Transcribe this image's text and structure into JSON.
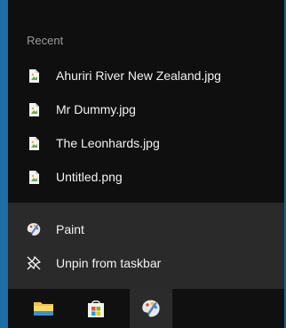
{
  "jumplist": {
    "recent_header": "Recent",
    "recent_files": [
      {
        "name": "Ahuriri River New Zealand.jpg",
        "icon": "image-file-icon"
      },
      {
        "name": "Mr Dummy.jpg",
        "icon": "image-file-icon"
      },
      {
        "name": "The Leonhards.jpg",
        "icon": "image-file-icon"
      },
      {
        "name": "Untitled.png",
        "icon": "image-file-icon"
      }
    ],
    "tasks": [
      {
        "label": "Paint",
        "icon": "paint-palette-icon"
      },
      {
        "label": "Unpin from taskbar",
        "icon": "unpin-icon"
      }
    ]
  },
  "taskbar": {
    "buttons": [
      {
        "name": "File Explorer",
        "icon": "folder-icon",
        "active": false
      },
      {
        "name": "Microsoft Store",
        "icon": "store-bag-icon",
        "active": false
      },
      {
        "name": "Paint",
        "icon": "paint-palette-icon",
        "active": true
      }
    ]
  },
  "colors": {
    "menu_background": "#0f0f0f",
    "tasks_background": "#2a2a2a",
    "taskbar_background": "#101010",
    "active_taskbar_button": "#2b2b2b",
    "desktop_edge": "#1c6ea4"
  }
}
